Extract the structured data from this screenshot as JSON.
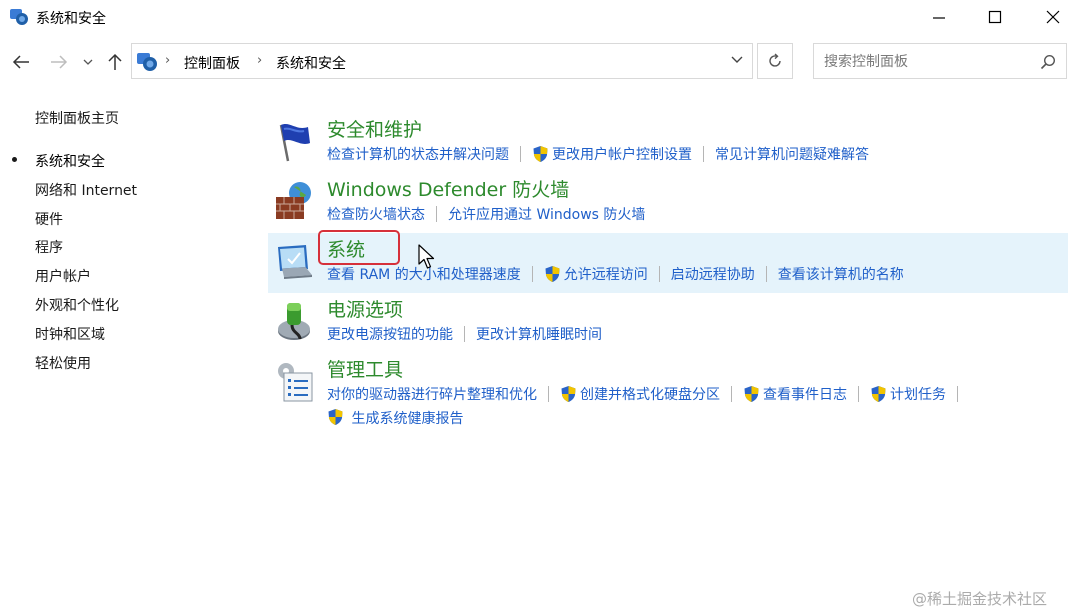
{
  "window": {
    "title": "系统和安全",
    "colors": {
      "accent_green": "#2d8a2d",
      "link_blue": "#1f5fc9",
      "hover_bg": "#e5f3fb",
      "highlight_red": "#d6303a"
    }
  },
  "address_bar": {
    "breadcrumbs": [
      "控制面板",
      "系统和安全"
    ],
    "separator": "›"
  },
  "search": {
    "placeholder": "搜索控制面板"
  },
  "left_nav": {
    "home": "控制面板主页",
    "items": [
      {
        "label": "系统和安全",
        "current": true
      },
      {
        "label": "网络和 Internet"
      },
      {
        "label": "硬件"
      },
      {
        "label": "程序"
      },
      {
        "label": "用户帐户"
      },
      {
        "label": "外观和个性化"
      },
      {
        "label": "时钟和区域"
      },
      {
        "label": "轻松使用"
      }
    ]
  },
  "categories": [
    {
      "title": "安全和维护",
      "icon": "flag-icon",
      "links": [
        {
          "label": "检查计算机的状态并解决问题",
          "shield": false
        },
        {
          "label": "更改用户帐户控制设置",
          "shield": true
        },
        {
          "label": "常见计算机问题疑难解答",
          "shield": false
        }
      ]
    },
    {
      "title": "Windows Defender 防火墙",
      "icon": "firewall-icon",
      "links": [
        {
          "label": "检查防火墙状态",
          "shield": false
        },
        {
          "label": "允许应用通过 Windows 防火墙",
          "shield": false
        }
      ]
    },
    {
      "title": "系统",
      "icon": "computer-icon",
      "links": [
        {
          "label": "查看 RAM 的大小和处理器速度",
          "shield": false
        },
        {
          "label": "允许远程访问",
          "shield": true
        },
        {
          "label": "启动远程协助",
          "shield": false
        },
        {
          "label": "查看该计算机的名称",
          "shield": false
        }
      ]
    },
    {
      "title": "电源选项",
      "icon": "power-icon",
      "links": [
        {
          "label": "更改电源按钮的功能",
          "shield": false
        },
        {
          "label": "更改计算机睡眠时间",
          "shield": false
        }
      ]
    },
    {
      "title": "管理工具",
      "icon": "admin-tools-icon",
      "links": [
        {
          "label": "对你的驱动器进行碎片整理和优化",
          "shield": false
        },
        {
          "label": "创建并格式化硬盘分区",
          "shield": true
        },
        {
          "label": "查看事件日志",
          "shield": true
        },
        {
          "label": "计划任务",
          "shield": true
        }
      ],
      "links_row2": [
        {
          "label": "生成系统健康报告",
          "shield": true
        }
      ]
    }
  ],
  "watermark": "@稀土掘金技术社区"
}
